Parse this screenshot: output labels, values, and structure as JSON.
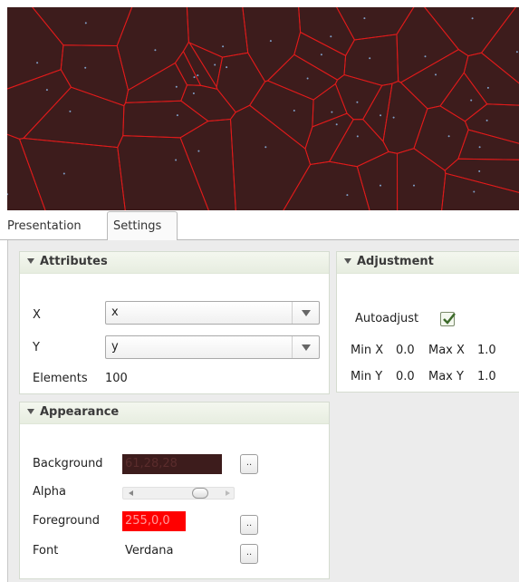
{
  "tabs": [
    {
      "label": "Presentation",
      "active": false
    },
    {
      "label": "Settings",
      "active": true
    }
  ],
  "colors": {
    "canvas_bg": "#3d1c1c",
    "cell_edge": "#e01b1b",
    "point": "#7fa0c8",
    "background_swatch": "#3d1c1c",
    "foreground_swatch": "#ff0000"
  },
  "attributes": {
    "title": "Attributes",
    "x_label": "X",
    "x_value": "x",
    "y_label": "Y",
    "y_value": "y",
    "elements_label": "Elements",
    "elements_value": "100"
  },
  "adjustment": {
    "title": "Adjustment",
    "autoadjust_label": "Autoadjust",
    "autoadjust_checked": true,
    "min_x_label": "Min X",
    "min_x_value": "0.0",
    "max_x_label": "Max X",
    "max_x_value": "1.0",
    "min_y_label": "Min Y",
    "min_y_value": "0.0",
    "max_y_label": "Max Y",
    "max_y_value": "1.0"
  },
  "appearance": {
    "title": "Appearance",
    "background_label": "Background",
    "background_value": "61,28,28",
    "background_button": "..",
    "alpha_label": "Alpha",
    "alpha_value": 0.8,
    "foreground_label": "Foreground",
    "foreground_value": "255,0,0",
    "foreground_button": "..",
    "font_label": "Font",
    "font_value": "Verdana",
    "font_button": ".."
  }
}
